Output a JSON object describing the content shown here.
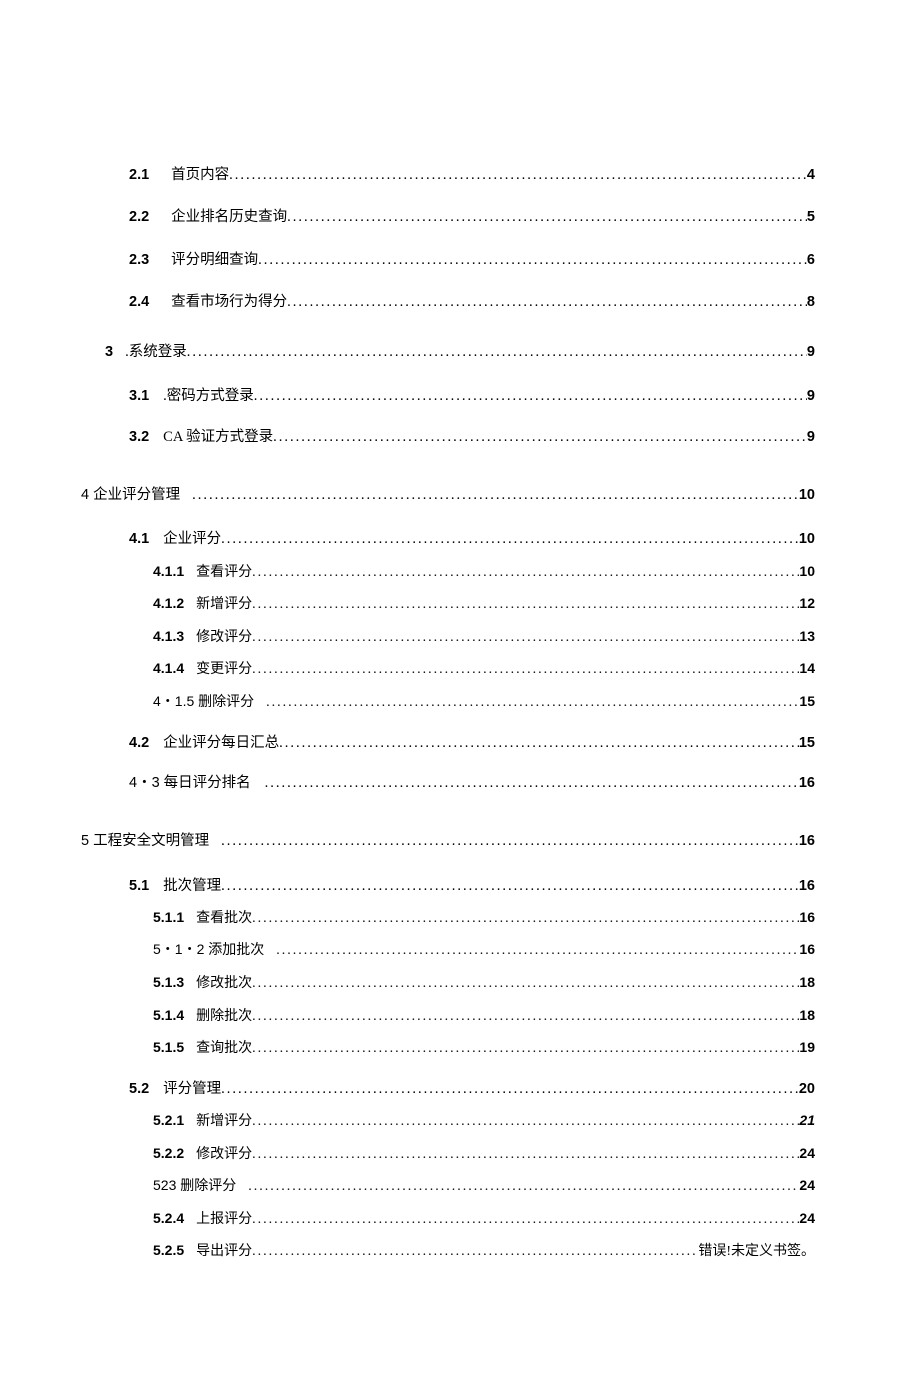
{
  "toc": {
    "e1": {
      "num": "2.1",
      "label": "首页内容",
      "page": "4"
    },
    "e2": {
      "num": "2.2",
      "label": "企业排名历史查询",
      "page": "5"
    },
    "e3": {
      "num": "2.3",
      "label": "评分明细查询",
      "page": "6"
    },
    "e4": {
      "num": "2.4",
      "label": "查看市场行为得分",
      "page": "8"
    },
    "e5": {
      "num": "3",
      "label": ".系统登录",
      "page": "9"
    },
    "e6": {
      "num": "3.1",
      "label": ".密码方式登录",
      "page": "9"
    },
    "e7": {
      "num": "3.2",
      "label": "CA 验证方式登录",
      "page": "9"
    },
    "e8": {
      "num": "4 企业评分管理",
      "label": "",
      "page": "10"
    },
    "e9": {
      "num": "4.1",
      "label": "企业评分",
      "page": "10"
    },
    "e10": {
      "num": "4.1.1",
      "label": "查看评分",
      "page": "10"
    },
    "e11": {
      "num": "4.1.2",
      "label": "新增评分",
      "page": "12"
    },
    "e12": {
      "num": "4.1.3",
      "label": "修改评分",
      "page": "13"
    },
    "e13": {
      "num": "4.1.4",
      "label": "变更评分",
      "page": "14"
    },
    "e14": {
      "num": "4・1.5 删除评分",
      "label": "",
      "page": "15"
    },
    "e15": {
      "num": "4.2",
      "label": "企业评分每日汇总",
      "page": "15"
    },
    "e16": {
      "num": "4・3 每日评分排名",
      "label": "",
      "page": "16"
    },
    "e17": {
      "num": "5 工程安全文明管理",
      "label": "",
      "page": "16"
    },
    "e18": {
      "num": "5.1",
      "label": "批次管理",
      "page": "16"
    },
    "e19": {
      "num": "5.1.1",
      "label": "查看批次",
      "page": "16"
    },
    "e20": {
      "num": "5・1・2 添加批次",
      "label": "",
      "page": "16"
    },
    "e21": {
      "num": "5.1.3",
      "label": "修改批次",
      "page": "18"
    },
    "e22": {
      "num": "5.1.4",
      "label": "删除批次",
      "page": "18"
    },
    "e23": {
      "num": "5.1.5",
      "label": "查询批次",
      "page": "19"
    },
    "e24": {
      "num": "5.2",
      "label": "评分管理",
      "page": "20"
    },
    "e25": {
      "num": "5.2.1",
      "label": "新增评分",
      "page": "21"
    },
    "e26": {
      "num": "5.2.2",
      "label": "修改评分",
      "page": "24"
    },
    "e27": {
      "num": "523 删除评分",
      "label": "",
      "page": "24"
    },
    "e28": {
      "num": "5.2.4",
      "label": "上报评分",
      "page": "24"
    },
    "e29": {
      "num": "5.2.5",
      "label": "导出评分",
      "page": "错误!未定义书签。"
    }
  }
}
